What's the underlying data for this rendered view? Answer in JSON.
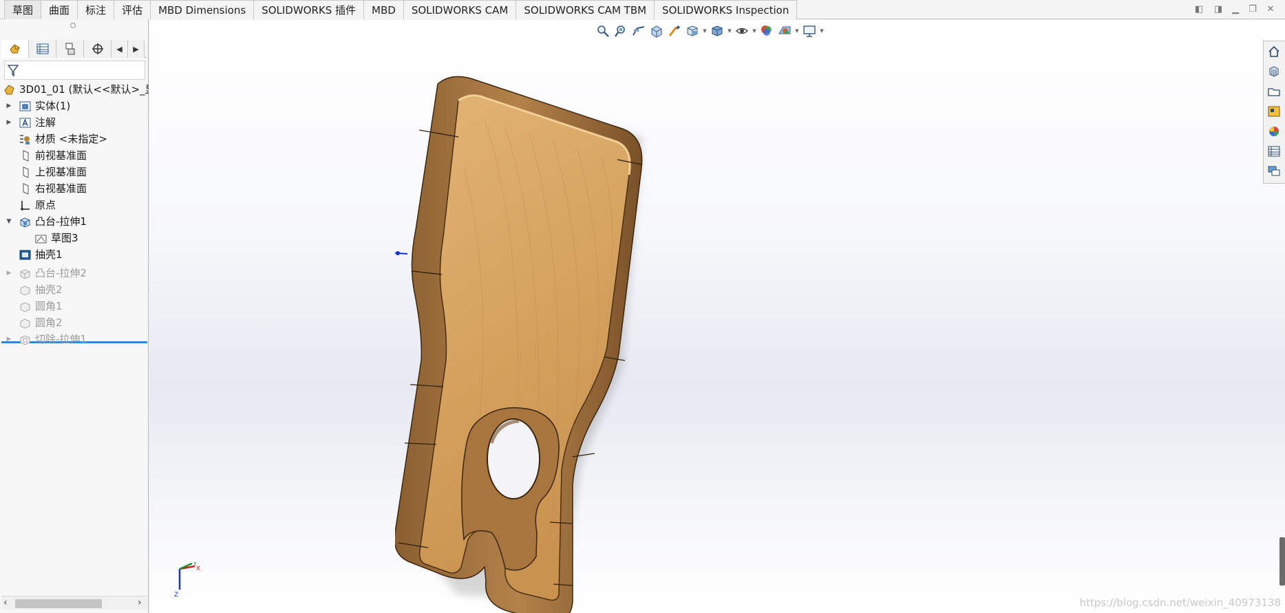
{
  "command_tabs": [
    "草图",
    "曲面",
    "标注",
    "评估",
    "MBD Dimensions",
    "SOLIDWORKS 插件",
    "MBD",
    "SOLIDWORKS CAM",
    "SOLIDWORKS CAM TBM",
    "SOLIDWORKS Inspection"
  ],
  "active_tab": "草图",
  "feature_tree": {
    "root": "3D01_01  (默认<<默认>_显",
    "items": [
      {
        "label": "实体(1)",
        "icon": "solid-bodies-icon",
        "expandable": true
      },
      {
        "label": "注解",
        "icon": "annotations-icon",
        "expandable": true
      },
      {
        "label": "材质 <未指定>",
        "icon": "material-icon",
        "expandable": false
      },
      {
        "label": "前视基准面",
        "icon": "plane-icon",
        "expandable": false
      },
      {
        "label": "上视基准面",
        "icon": "plane-icon",
        "expandable": false
      },
      {
        "label": "右视基准面",
        "icon": "plane-icon",
        "expandable": false
      },
      {
        "label": "原点",
        "icon": "origin-icon",
        "expandable": false
      },
      {
        "label": "凸台-拉伸1",
        "icon": "boss-extrude-icon",
        "expandable": true,
        "expanded": true
      },
      {
        "label": "草图3",
        "icon": "sketch-icon",
        "child": true
      },
      {
        "label": "抽壳1",
        "icon": "shell-icon",
        "expandable": false
      }
    ],
    "suppressed_items": [
      {
        "label": "凸台-拉伸2",
        "icon": "boss-extrude-icon",
        "expandable": true
      },
      {
        "label": "抽壳2",
        "icon": "shell-icon",
        "expandable": false
      },
      {
        "label": "圆角1",
        "icon": "fillet-icon",
        "expandable": false
      },
      {
        "label": "圆角2",
        "icon": "fillet-icon",
        "expandable": false
      },
      {
        "label": "切除-拉伸1",
        "icon": "cut-extrude-icon",
        "expandable": true
      }
    ]
  },
  "heads_up_toolbar": [
    "zoom-to-fit-icon",
    "zoom-area-icon",
    "previous-view-icon",
    "section-view-icon",
    "dynamic-annotation-icon",
    "view-orientation-icon",
    "display-style-icon",
    "hide-show-icon",
    "edit-appearance-icon",
    "apply-scene-icon",
    "view-settings-icon"
  ],
  "task_pane": [
    "home-icon",
    "design-library-icon",
    "file-explorer-icon",
    "view-palette-icon",
    "appearances-icon",
    "custom-properties-icon",
    "forum-icon"
  ],
  "triad": {
    "x": "X",
    "y": "Y",
    "z": "Z"
  },
  "watermark": "https://blog.csdn.net/weixin_40973138",
  "colors": {
    "wood_light": "#d8a664",
    "wood_mid": "#b07f46",
    "wood_dark": "#6e4a24",
    "rollback_bar": "#2f88d3"
  }
}
